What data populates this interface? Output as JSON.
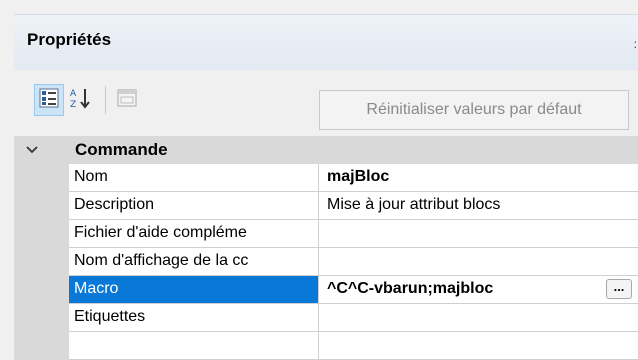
{
  "panel": {
    "title": "Propriétés",
    "edge_mark": ":"
  },
  "toolbar": {
    "categorized_icon": "categorized-view-icon",
    "alphabetical_icon": "sort-alphabetical-icon",
    "alphabetical_label": "A Z ↓",
    "pages_icon": "property-pages-icon",
    "reset_label": "Réinitialiser valeurs par défaut"
  },
  "grid": {
    "category": {
      "label": "Commande",
      "expanded": true,
      "icon": "chevron-down-icon"
    },
    "properties": [
      {
        "name": "Nom",
        "value": "majBloc",
        "bold": true,
        "selected": false
      },
      {
        "name": "Description",
        "value": "Mise à jour attribut blocs",
        "bold": false,
        "selected": false
      },
      {
        "name": "Fichier d'aide compléme",
        "value": "",
        "bold": false,
        "selected": false
      },
      {
        "name": "Nom d'affichage de la cc",
        "value": "",
        "bold": false,
        "selected": false
      },
      {
        "name": "Macro",
        "value": "^C^C-vbarun;majbloc",
        "bold": true,
        "selected": true,
        "button_label": "..."
      },
      {
        "name": "Etiquettes",
        "value": "",
        "bold": false,
        "selected": false
      }
    ]
  },
  "colors": {
    "selection": "#0a78d7",
    "category_band": "#d9d9d9",
    "header_background": "#e3e9f2"
  }
}
